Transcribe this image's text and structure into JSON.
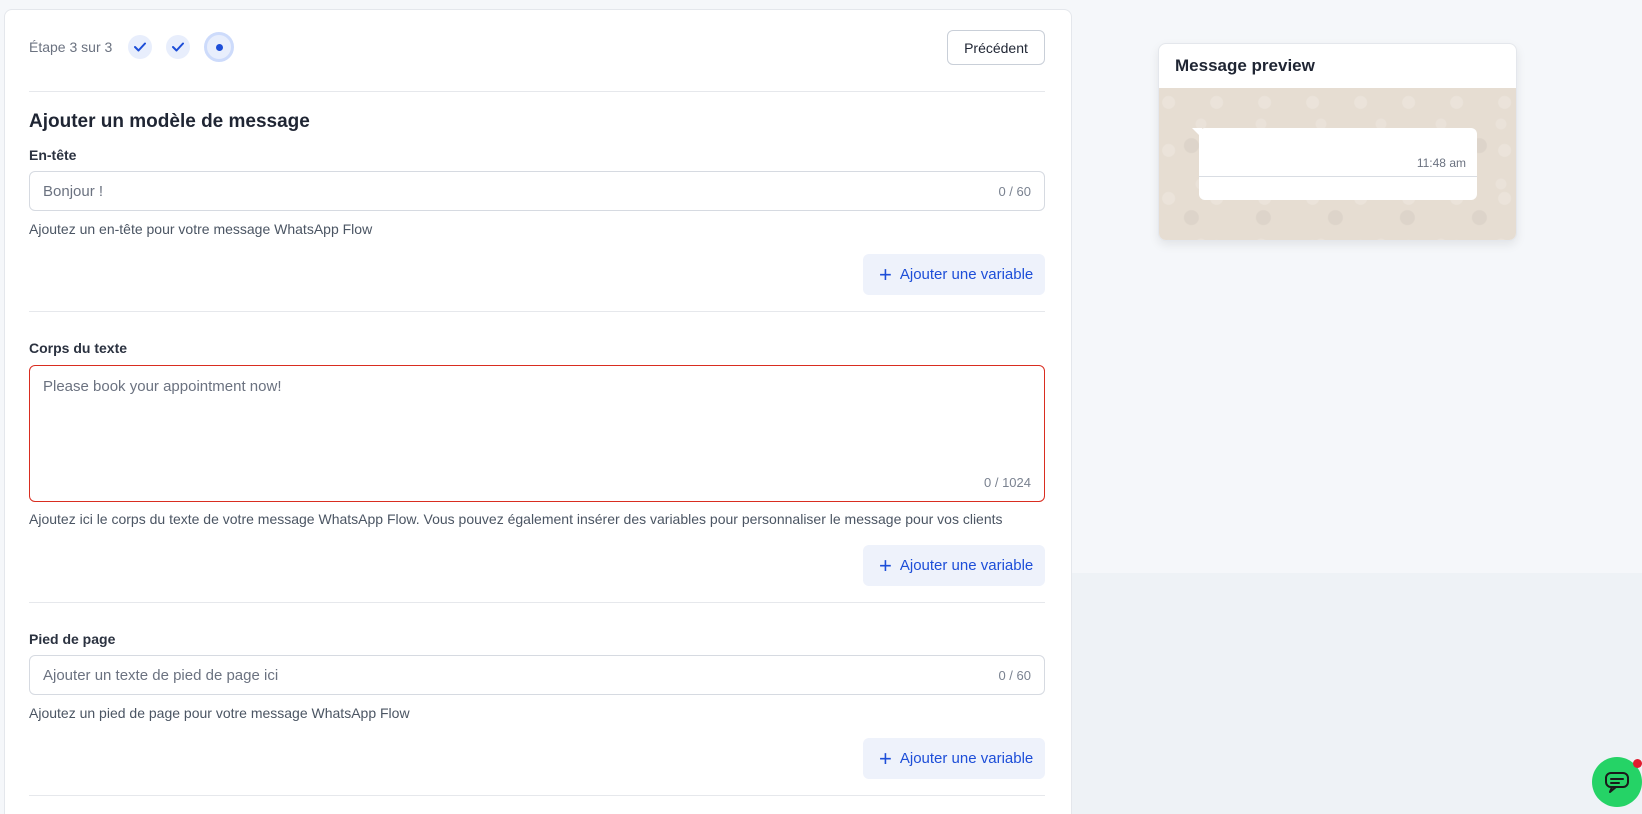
{
  "stepper": {
    "label": "Étape 3 sur 3"
  },
  "nav": {
    "previous_label": "Précédent"
  },
  "form": {
    "title": "Ajouter un modèle de message",
    "header": {
      "label": "En-tête",
      "placeholder": "Bonjour !",
      "count": "0 / 60",
      "helper": "Ajoutez un en-tête pour votre message WhatsApp Flow",
      "add_variable": "Ajouter une variable"
    },
    "body": {
      "label": "Corps du texte",
      "placeholder": "Please book your appointment now!",
      "count": "0 / 1024",
      "helper": "Ajoutez ici le corps du texte de votre message WhatsApp Flow. Vous pouvez également insérer des variables pour personnaliser le message pour vos clients",
      "add_variable": "Ajouter une variable"
    },
    "footer": {
      "label": "Pied de page",
      "placeholder": "Ajouter un texte de pied de page ici",
      "count": "0 / 60",
      "helper": "Ajoutez un pied de page pour votre message WhatsApp Flow",
      "add_variable": "Ajouter une variable"
    }
  },
  "preview": {
    "title": "Message preview",
    "time": "11:48 am"
  },
  "colors": {
    "accent": "#1d4ed8",
    "error": "#d92d20",
    "whatsapp_green": "#25d366"
  }
}
